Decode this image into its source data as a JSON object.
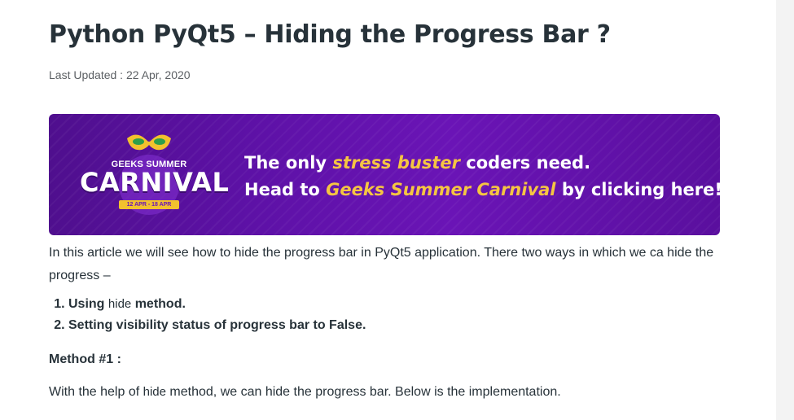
{
  "article": {
    "title": "Python PyQt5 – Hiding the Progress Bar ?",
    "last_updated": "Last Updated : 22 Apr, 2020",
    "intro": "In this article we will see how to hide the progress bar in PyQt5 application. There two ways in which we ca hide the progress –",
    "ways": [
      {
        "prefix": "Using ",
        "code": "hide",
        "suffix": " method."
      },
      {
        "text": "Setting visibility status of progress bar to False."
      }
    ],
    "method_heading": "Method #1 :",
    "impl_prefix": "With the help of ",
    "impl_code": "hide",
    "impl_suffix": " method, we can hide the progress bar. Below is the implementation."
  },
  "banner": {
    "logo_small": "GEEKS SUMMER",
    "logo_big": "CARNIVAL",
    "logo_dates": "12 APR - 18 APR",
    "line1_a": "The only ",
    "line1_hl": "stress buster",
    "line1_b": " coders need.",
    "line2_a": "Head to ",
    "line2_hl": "Geeks Summer Carnival",
    "line2_b": " by clicking here!",
    "colors": {
      "background": "#5d11a6",
      "highlight": "#f5c542"
    }
  }
}
